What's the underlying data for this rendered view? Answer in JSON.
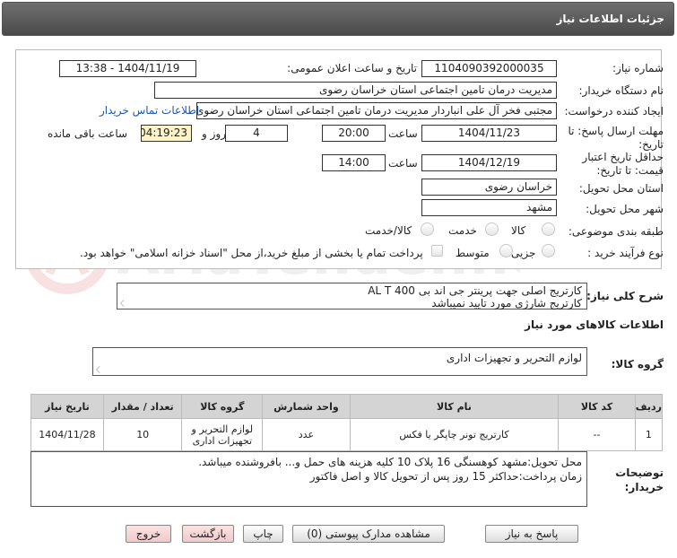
{
  "header": {
    "title": "جزئیات اطلاعات نیاز"
  },
  "form": {
    "need_number_label": "شماره نیاز:",
    "need_number": "1104090392000035",
    "announce_label": "تاریخ و ساعت اعلان عمومی:",
    "announce_value": "1404/11/19 - 13:38",
    "buyer_label": "نام دستگاه خریدار:",
    "buyer_value": "مدیریت درمان تامین اجتماعی استان خراسان رضوی",
    "creator_label": "ایجاد کننده درخواست:",
    "creator_value": "مجتبی فخر آل علی انباردار مدیریت درمان تامین اجتماعی استان خراسان رضوی",
    "contact_link": "اطلاعات تماس خریدار",
    "deadline_label": "مهلت ارسال پاسخ: تا تاریخ:",
    "deadline_date": "1404/11/23",
    "time_label": "ساعت",
    "deadline_time": "20:00",
    "days_value": "4",
    "days_label": "روز و",
    "remaining_time": "04:19:23",
    "remaining_label": "ساعت باقی مانده",
    "validity_label": "حداقل تاریخ اعتبار قیمت: تا تاریخ:",
    "validity_date": "1404/12/19",
    "validity_time": "14:00",
    "province_label": "استان محل تحویل:",
    "province_value": "خراسان رضوی",
    "city_label": "شهر محل تحویل:",
    "city_value": "مشهد",
    "category_label": "طبقه بندی موضوعی:",
    "category_options": [
      "کالا",
      "خدمت",
      "کالا/خدمت"
    ],
    "purchase_label": "نوع فرآیند خرید :",
    "purchase_options": [
      "جزیی",
      "متوسط"
    ],
    "payment_note": "پرداخت تمام یا بخشی از مبلغ خرید،از محل \"اسناد خزانه اسلامی\" خواهد بود."
  },
  "description": {
    "label": "شرح کلی نیاز:",
    "line1": "کارتریج اصلی جهت پرینتر جی اند بی  AL T 400",
    "line2": "کارتریج شارژی مورد تایید نمیباشد"
  },
  "goods_section": {
    "title": "اطلاعات کالاهای مورد نیاز",
    "group_label": "گروه کالا:",
    "group_value": "لوازم التحریر و تجهیزات اداری"
  },
  "table": {
    "headers": [
      "ردیف",
      "کد کالا",
      "نام کالا",
      "واحد شمارش",
      "گروه کالا",
      "تعداد / مقدار",
      "تاریخ نیاز"
    ],
    "rows": [
      [
        "1",
        "--",
        "کارتریج تونر چاپگر یا فکس",
        "عدد",
        "لوازم التحریر و تجهیزات اداری",
        "10",
        "1404/11/28"
      ]
    ]
  },
  "buyer_notes": {
    "label": "توضیحات خریدار:",
    "line1": "محل تحویل:مشهد کوهسنگی 16 پلاک 10 کلیه هزینه های حمل و... بافروشنده میباشد.",
    "line2": "زمان پرداخت:حداکثر 15 روز پس از تحویل کالا و اصل فاکتور"
  },
  "buttons": {
    "reply": "پاسخ به نیاز",
    "attachments": "مشاهده مدارک پیوستی (0)",
    "print": "چاپ",
    "back": "بازگشت",
    "exit": "خروج"
  },
  "watermark": "AriaTender.net"
}
